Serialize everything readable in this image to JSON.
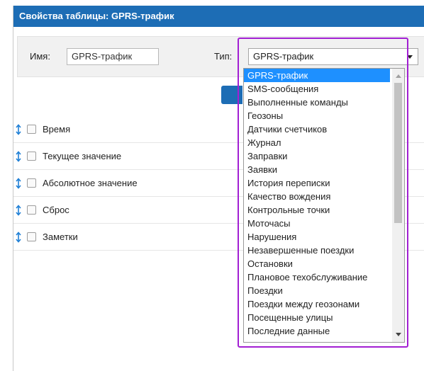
{
  "dialog": {
    "title": "Свойства таблицы: GPRS-трафик"
  },
  "form": {
    "name_label": "Имя:",
    "name_value": "GPRS-трафик",
    "type_label": "Тип:",
    "type_value": "GPRS-трафик"
  },
  "columns": [
    {
      "label": "Время",
      "checked": false
    },
    {
      "label": "Текущее значение",
      "checked": false
    },
    {
      "label": "Абсолютное значение",
      "checked": false
    },
    {
      "label": "Сброс",
      "checked": false
    },
    {
      "label": "Заметки",
      "checked": false
    }
  ],
  "type_options": [
    "GPRS-трафик",
    "SMS-сообщения",
    "Выполненные команды",
    "Геозоны",
    "Датчики счетчиков",
    "Журнал",
    "Заправки",
    "Заявки",
    "История переписки",
    "Качество вождения",
    "Контрольные точки",
    "Моточасы",
    "Нарушения",
    "Незавершенные поездки",
    "Остановки",
    "Плановое техобслуживание",
    "Поездки",
    "Поездки между геозонами",
    "Посещенные улицы",
    "Последние данные"
  ],
  "selected_option_index": 0,
  "colors": {
    "header": "#1d6db5",
    "selected": "#1e90ff",
    "highlight": "#a21fd3",
    "drag_icon": "#1e7fd6"
  },
  "icons": {
    "drag_handle": "drag-handle-icon",
    "dropdown_arrow": "chevron-down-icon"
  }
}
